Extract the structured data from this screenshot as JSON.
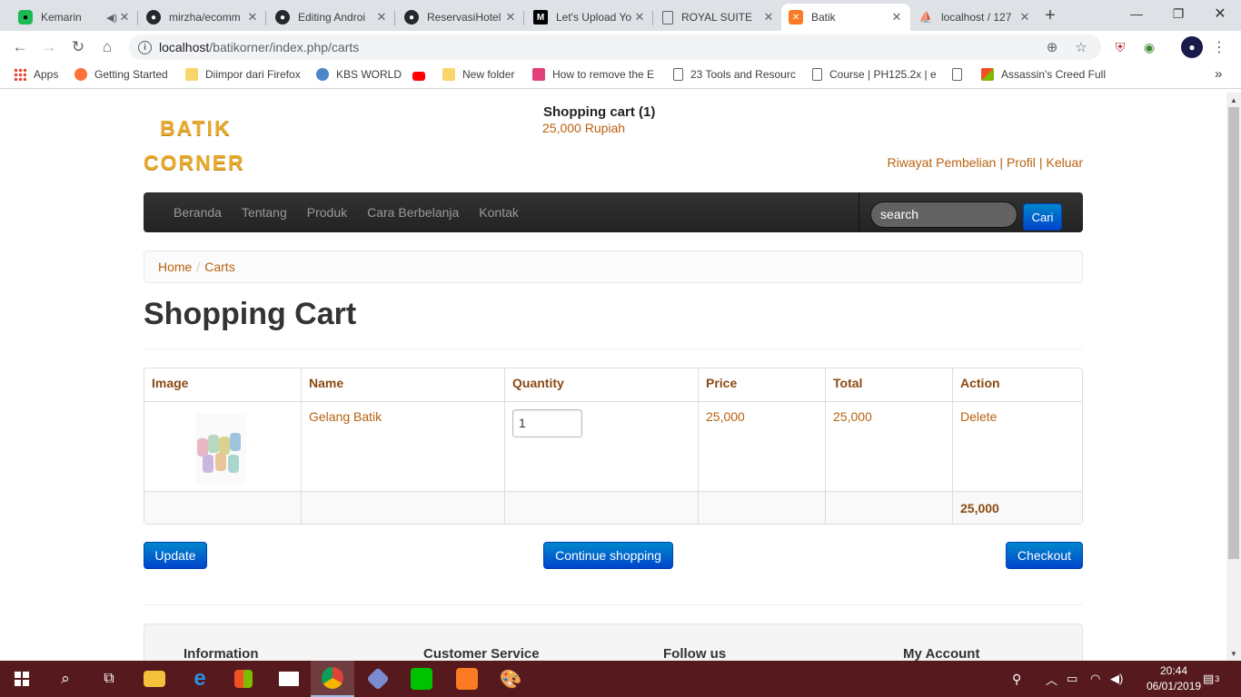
{
  "browser": {
    "tabs": [
      {
        "title": "Kemarin",
        "icon": "app-icon"
      },
      {
        "title": "mirzha/ecomm",
        "icon": "github-icon"
      },
      {
        "title": "Editing Androi",
        "icon": "github-icon"
      },
      {
        "title": "ReservasiHotel",
        "icon": "github-icon"
      },
      {
        "title": "Let's Upload Yo",
        "icon": "medium-icon"
      },
      {
        "title": "ROYAL SUITE",
        "icon": "page-icon"
      },
      {
        "title": "Batik",
        "icon": "xampp-icon",
        "active": true
      },
      {
        "title": "localhost / 127",
        "icon": "phpmyadmin-icon"
      }
    ],
    "new_tab": "+",
    "url_host": "localhost",
    "url_path": "/batikorner/index.php/carts",
    "bookmarks": [
      {
        "label": "Apps"
      },
      {
        "label": "Getting Started"
      },
      {
        "label": "Diimpor dari Firefox"
      },
      {
        "label": "KBS WORLD"
      },
      {
        "label": ""
      },
      {
        "label": "New folder"
      },
      {
        "label": "How to remove the E"
      },
      {
        "label": "23 Tools and Resourc"
      },
      {
        "label": "Course | PH125.2x | e"
      },
      {
        "label": "Assassin's Creed Full"
      }
    ],
    "bookmarks_more": "»"
  },
  "site": {
    "logo_line1": "BATIK",
    "logo_line2": "CORNER",
    "cart_summary_title": "Shopping cart (1)",
    "cart_summary_total": "25,000 Rupiah",
    "user_links": [
      "Riwayat Pembelian",
      "Profil",
      "Keluar"
    ],
    "menu": [
      "Beranda",
      "Tentang",
      "Produk",
      "Cara Berbelanja",
      "Kontak"
    ],
    "search_placeholder": "search",
    "search_button": "Cari",
    "breadcrumb": [
      "Home",
      "Carts"
    ],
    "breadcrumb_divider": "/",
    "page_title": "Shopping Cart"
  },
  "cart": {
    "columns": [
      "Image",
      "Name",
      "Quantity",
      "Price",
      "Total",
      "Action"
    ],
    "items": [
      {
        "name": "Gelang Batik",
        "quantity": "1",
        "price": "25,000",
        "total": "25,000",
        "action": "Delete"
      }
    ],
    "grand_total": "25,000",
    "buttons": {
      "update": "Update",
      "continue": "Continue shopping",
      "checkout": "Checkout"
    }
  },
  "footer": {
    "headings": [
      "Information",
      "Customer Service",
      "Follow us",
      "My Account"
    ]
  },
  "taskbar": {
    "time": "20:44",
    "date": "06/01/2019",
    "notification_count": "3"
  },
  "colors": {
    "accent_link": "#b8620f",
    "logo": "#e8a92c",
    "button_blue": "#0055cc",
    "navbar": "#2a2a2a",
    "taskbar": "#561a1e"
  }
}
